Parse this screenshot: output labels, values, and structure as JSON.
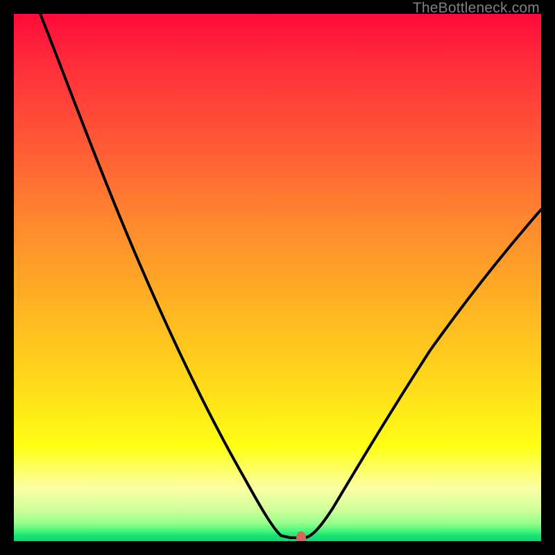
{
  "watermark": "TheBottleneck.com",
  "colors": {
    "page_bg": "#000000",
    "curve": "#000000",
    "marker": "#d4665a",
    "watermark": "#808080"
  },
  "chart_data": {
    "type": "line",
    "title": "",
    "xlabel": "",
    "ylabel": "",
    "xlim": [
      0,
      100
    ],
    "ylim": [
      0,
      100
    ],
    "legend": false,
    "grid": false,
    "background": "rainbow-vertical-gradient (red top → green bottom)",
    "series": [
      {
        "name": "bottleneck-curve",
        "x": [
          5,
          10,
          15,
          20,
          25,
          30,
          35,
          40,
          45,
          48,
          50,
          51,
          52,
          53,
          55,
          56,
          60,
          65,
          70,
          75,
          80,
          85,
          90,
          95,
          100
        ],
        "y": [
          100,
          88,
          77,
          67,
          57,
          47,
          37,
          27,
          16,
          8,
          3,
          1,
          0.5,
          0.5,
          0.5,
          1,
          6,
          14,
          22,
          30,
          38,
          45,
          52,
          58,
          63
        ]
      }
    ],
    "annotations": [
      {
        "name": "optimal-marker",
        "shape": "ellipse",
        "x": 54.5,
        "y": 0.5,
        "color": "#d4665a"
      }
    ]
  }
}
